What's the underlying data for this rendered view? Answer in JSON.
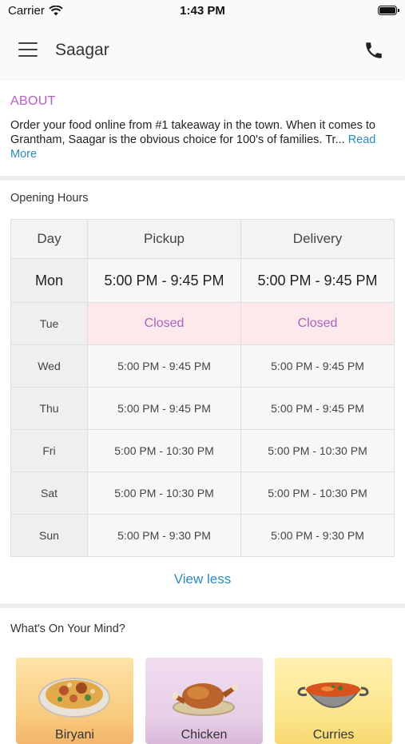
{
  "status_bar": {
    "carrier": "Carrier",
    "time": "1:43 PM"
  },
  "header": {
    "title": "Saagar"
  },
  "about": {
    "heading": "ABOUT",
    "text": "Order your food online from #1 takeaway in the town. When it comes to Grantham, Saagar is the obvious choice for 100's of families. Tr",
    "ellipsis": "...",
    "read_more": "Read More"
  },
  "hours": {
    "heading": "Opening Hours",
    "columns": [
      "Day",
      "Pickup",
      "Delivery"
    ],
    "rows": [
      {
        "day": "Mon",
        "pickup": "5:00 PM - 9:45 PM",
        "delivery": "5:00 PM - 9:45 PM"
      },
      {
        "day": "Tue",
        "pickup": "Closed",
        "delivery": "Closed"
      },
      {
        "day": "Wed",
        "pickup": "5:00 PM - 9:45 PM",
        "delivery": "5:00 PM - 9:45 PM"
      },
      {
        "day": "Thu",
        "pickup": "5:00 PM - 9:45 PM",
        "delivery": "5:00 PM - 9:45 PM"
      },
      {
        "day": "Fri",
        "pickup": "5:00 PM - 10:30 PM",
        "delivery": "5:00 PM - 10:30 PM"
      },
      {
        "day": "Sat",
        "pickup": "5:00 PM - 10:30 PM",
        "delivery": "5:00 PM - 10:30 PM"
      },
      {
        "day": "Sun",
        "pickup": "5:00 PM - 9:30 PM",
        "delivery": "5:00 PM - 9:30 PM"
      }
    ],
    "view_less": "View less"
  },
  "mind": {
    "heading": "What's On Your Mind?",
    "cards": [
      {
        "label": "Biryani",
        "icon": "biryani-dish-icon"
      },
      {
        "label": "Chicken",
        "icon": "roast-chicken-icon"
      },
      {
        "label": "Curries",
        "icon": "curry-pot-icon"
      }
    ]
  },
  "colors": {
    "accent_purple": "#b55cc8",
    "link_blue": "#2a8bbd",
    "closed_bg": "#fde8ec"
  }
}
